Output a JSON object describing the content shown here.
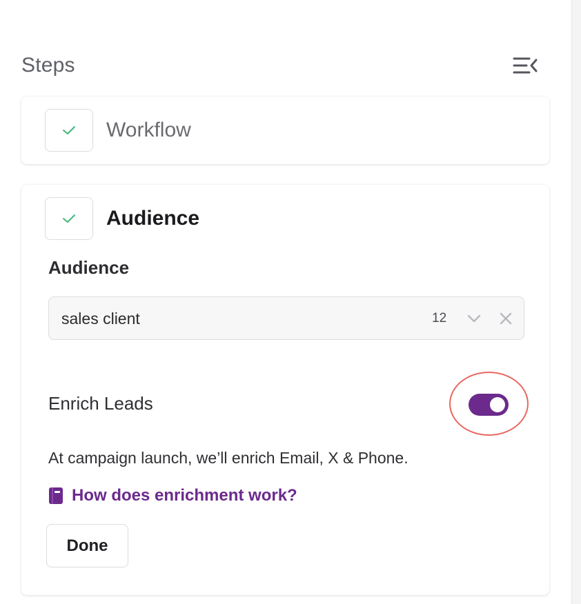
{
  "sidebar": {
    "title": "Steps",
    "collapse_icon": "collapse-panel-icon"
  },
  "steps": [
    {
      "label": "Workflow",
      "status": "completed",
      "icon": "check-icon"
    },
    {
      "label": "Audience",
      "status": "completed",
      "icon": "check-icon",
      "expanded": true
    }
  ],
  "audience": {
    "field_label": "Audience",
    "selected_value": "sales client",
    "count": "12",
    "chevron_icon": "chevron-down-icon",
    "clear_icon": "close-icon"
  },
  "enrich": {
    "label": "Enrich Leads",
    "enabled": true,
    "description": "At campaign launch, we’ll enrich Email, X & Phone.",
    "help_link": "How does enrichment work?",
    "help_icon": "book-icon"
  },
  "actions": {
    "done_label": "Done"
  },
  "colors": {
    "accent": "#6b2a8c",
    "check": "#3fb57a",
    "highlight": "#e8685f"
  }
}
